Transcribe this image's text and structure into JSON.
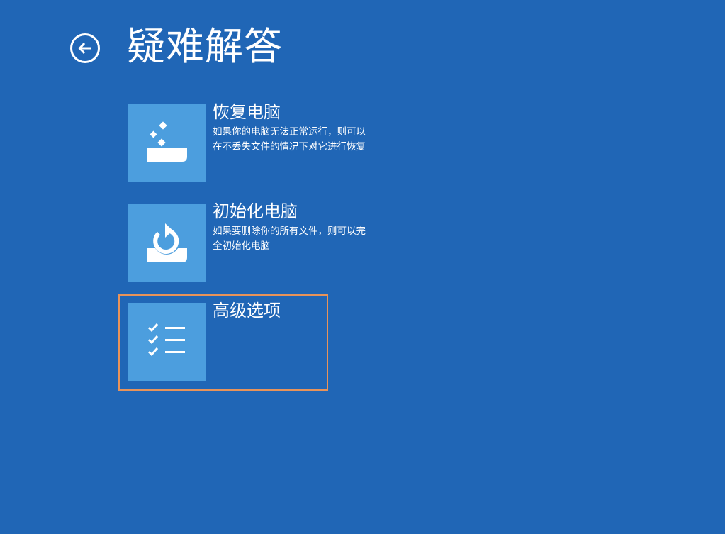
{
  "page": {
    "title": "疑难解答"
  },
  "header": {
    "back_icon": "back-arrow-icon"
  },
  "options": [
    {
      "title": "恢复电脑",
      "description_lines": [
        "如果你的电脑无法正常运行，则可以",
        "在不丢失文件的情况下对它进行恢复"
      ],
      "icon": "refresh-drive-icon"
    },
    {
      "title": "初始化电脑",
      "description_lines": [
        "如果要删除你的所有文件，则可以完",
        "全初始化电脑"
      ],
      "icon": "reset-drive-icon"
    },
    {
      "title": "高级选项",
      "description_lines": [],
      "icon": "checklist-icon"
    }
  ],
  "colors": {
    "background": "#2066b6",
    "tile": "#4c9ede",
    "highlight": "#e8935a",
    "text": "#ffffff"
  }
}
